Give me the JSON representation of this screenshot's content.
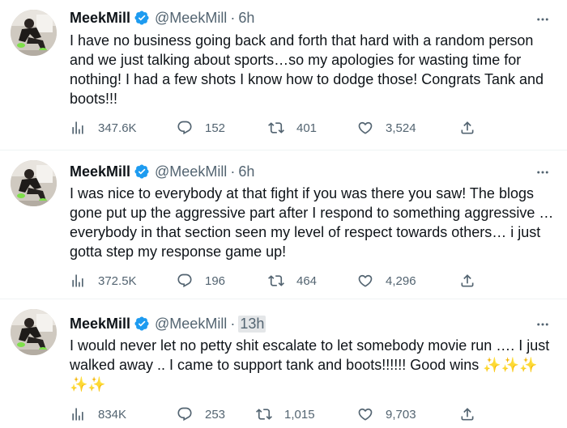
{
  "tweets": [
    {
      "name": "MeekMill",
      "handle": "@MeekMill",
      "separator": "·",
      "time": "6h",
      "text": "I have no business going back and forth that hard with a random person and we just talking about sports…so my apologies for wasting time for nothing! I had a few shots I know how to dodge those! Congrats Tank and boots!!!",
      "views": "347.6K",
      "replies": "152",
      "retweets": "401",
      "likes": "3,524"
    },
    {
      "name": "MeekMill",
      "handle": "@MeekMill",
      "separator": "·",
      "time": "6h",
      "text": "I was nice to everybody at that fight if you was there you saw! The blogs gone put up the aggressive part after I respond to something aggressive … everybody in that section seen my level of respect towards others… i just gotta step my response game up!",
      "views": "372.5K",
      "replies": "196",
      "retweets": "464",
      "likes": "4,296"
    },
    {
      "name": "MeekMill",
      "handle": "@MeekMill",
      "separator": "·",
      "time": "13h",
      "text": "I would never let no petty shit escalate to let somebody movie run …. I just walked away .. I came to support tank and boots!!!!!! Good wins ✨✨✨ ✨✨",
      "views": "834K",
      "replies": "253",
      "retweets": "1,015",
      "likes": "9,703"
    }
  ],
  "colors": {
    "text": "#0f1419",
    "secondary": "#536471",
    "verified": "#1d9bf0",
    "divider": "#eff3f4",
    "time_highlight": "#e4e6e8"
  },
  "icons": {
    "views": "bar-chart-icon",
    "reply": "speech-bubble-icon",
    "retweet": "retweet-arrows-icon",
    "like": "heart-icon",
    "share": "share-upload-icon",
    "more": "more-dots-icon",
    "verified": "verified-badge-icon"
  }
}
